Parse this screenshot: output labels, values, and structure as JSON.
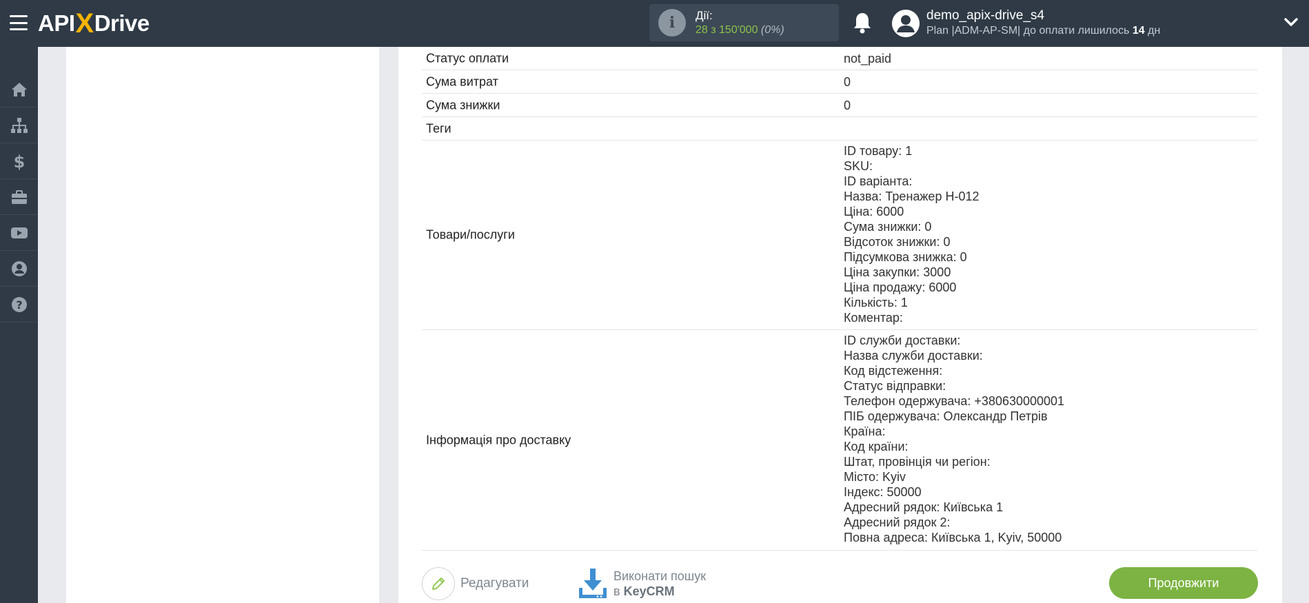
{
  "header": {
    "logo": {
      "part1": "API",
      "x": "X",
      "part2": "Drive"
    },
    "actions": {
      "label": "Дії:",
      "value": "28 з 150'000",
      "percent": "(0%)"
    },
    "user": {
      "name": "demo_apix-drive_s4",
      "plan_prefix": "Plan |ADM-AP-SM| до оплати лишилось ",
      "days": "14",
      "plan_suffix": " дн"
    }
  },
  "sidebar": {
    "items": [
      {
        "icon": "home-icon"
      },
      {
        "icon": "sitemap-icon"
      },
      {
        "icon": "dollar-icon"
      },
      {
        "icon": "briefcase-icon"
      },
      {
        "icon": "youtube-icon"
      },
      {
        "icon": "user-circle-icon"
      },
      {
        "icon": "help-icon"
      }
    ]
  },
  "table": {
    "rows": [
      {
        "key": "Статус оплати",
        "value": "not_paid"
      },
      {
        "key": "Сума витрат",
        "value": "0"
      },
      {
        "key": "Сума знижки",
        "value": "0"
      },
      {
        "key": "Теги",
        "value": ""
      }
    ],
    "goods": {
      "key": "Товари/послуги",
      "lines": [
        "ID товару: 1",
        "SKU:",
        "ID варіанта:",
        "Назва: Тренажер H-012",
        "Ціна: 6000",
        "Сума знижки: 0",
        "Відсоток знижки: 0",
        "Підсумкова знижка: 0",
        "Ціна закупки: 3000",
        "Ціна продажу: 6000",
        "Кількість: 1",
        "Коментар:"
      ]
    },
    "delivery": {
      "key": "Інформація про доставку",
      "lines": [
        "ID служби доставки:",
        "Назва служби доставки:",
        "Код відстеження:",
        "Статус відправки:",
        "Телефон одержувача: +380630000001",
        "ПІБ одержувача: Олександр Петрів",
        "Країна:",
        "Код країни:",
        "Штат, провінція чи регіон:",
        "Місто: Kyiv",
        "Індекс: 50000",
        "Адресний рядок: Київська 1",
        "Адресний рядок 2:",
        "Повна адреса: Київська 1, Kyiv, 50000"
      ]
    }
  },
  "footer": {
    "edit_label": "Редагувати",
    "search_line1": "Виконати пошук",
    "search_line2_prefix": "в ",
    "search_line2_bold": "KeyCRM",
    "continue_label": "Продовжити"
  },
  "colors": {
    "topbar": "#2f3a46",
    "accent_green": "#7cb342",
    "logo_x": "#f5b301"
  }
}
